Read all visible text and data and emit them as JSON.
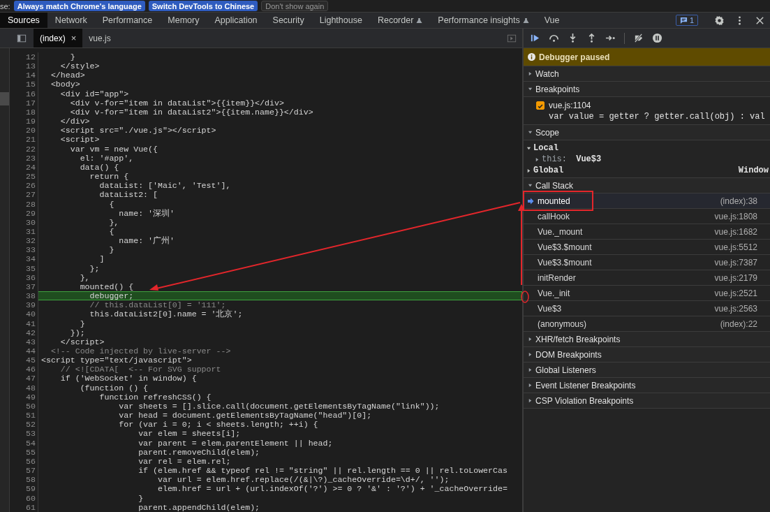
{
  "infobar": {
    "prefix": "se:",
    "buttons": [
      "Always match Chrome's language",
      "Switch DevTools to Chinese"
    ],
    "dismiss": "Don't show again"
  },
  "tabs": [
    {
      "label": "Sources",
      "selected": true,
      "experimental": false
    },
    {
      "label": "Network",
      "selected": false,
      "experimental": false
    },
    {
      "label": "Performance",
      "selected": false,
      "experimental": false
    },
    {
      "label": "Memory",
      "selected": false,
      "experimental": false
    },
    {
      "label": "Application",
      "selected": false,
      "experimental": false
    },
    {
      "label": "Security",
      "selected": false,
      "experimental": false
    },
    {
      "label": "Lighthouse",
      "selected": false,
      "experimental": false
    },
    {
      "label": "Recorder",
      "selected": false,
      "experimental": true
    },
    {
      "label": "Performance insights",
      "selected": false,
      "experimental": true
    },
    {
      "label": "Vue",
      "selected": false,
      "experimental": false
    }
  ],
  "issues_badge": "1",
  "file_tabs": [
    {
      "label": "(index)",
      "selected": true,
      "close": "×"
    },
    {
      "label": "vue.js",
      "selected": false
    }
  ],
  "code": {
    "lines": [
      {
        "number": "12",
        "text": "      }",
        "kind": "code",
        "paused": false
      },
      {
        "number": "13",
        "text": "    </style>",
        "kind": "code",
        "paused": false
      },
      {
        "number": "14",
        "text": "  </head>",
        "kind": "code",
        "paused": false
      },
      {
        "number": "15",
        "text": "  <body>",
        "kind": "code",
        "paused": false
      },
      {
        "number": "16",
        "text": "    <div id=\"app\">",
        "kind": "code",
        "paused": false
      },
      {
        "number": "17",
        "text": "      <div v-for=\"item in dataList\">{{item}}</div>",
        "kind": "code",
        "paused": false
      },
      {
        "number": "18",
        "text": "      <div v-for=\"item in dataList2\">{{item.name}}</div>",
        "kind": "code",
        "paused": false
      },
      {
        "number": "19",
        "text": "    </div>",
        "kind": "code",
        "paused": false
      },
      {
        "number": "20",
        "text": "    <script src=\"./vue.js\"></script>",
        "kind": "code",
        "paused": false
      },
      {
        "number": "21",
        "text": "    <script>",
        "kind": "code",
        "paused": false
      },
      {
        "number": "22",
        "text": "      var vm = new Vue({",
        "kind": "code",
        "paused": false
      },
      {
        "number": "23",
        "text": "        el: '#app',",
        "kind": "code",
        "paused": false
      },
      {
        "number": "24",
        "text": "        data() {",
        "kind": "code",
        "paused": false
      },
      {
        "number": "25",
        "text": "          return {",
        "kind": "code",
        "paused": false
      },
      {
        "number": "26",
        "text": "            dataList: ['Maic', 'Test'],",
        "kind": "code",
        "paused": false
      },
      {
        "number": "27",
        "text": "            dataList2: [",
        "kind": "code",
        "paused": false
      },
      {
        "number": "28",
        "text": "              {",
        "kind": "code",
        "paused": false
      },
      {
        "number": "29",
        "text": "                name: '深圳'",
        "kind": "code",
        "paused": false
      },
      {
        "number": "30",
        "text": "              },",
        "kind": "code",
        "paused": false
      },
      {
        "number": "31",
        "text": "              {",
        "kind": "code",
        "paused": false
      },
      {
        "number": "32",
        "text": "                name: '广州'",
        "kind": "code",
        "paused": false
      },
      {
        "number": "33",
        "text": "              }",
        "kind": "code",
        "paused": false
      },
      {
        "number": "34",
        "text": "            ]",
        "kind": "code",
        "paused": false
      },
      {
        "number": "35",
        "text": "          };",
        "kind": "code",
        "paused": false
      },
      {
        "number": "36",
        "text": "        },",
        "kind": "code",
        "paused": false
      },
      {
        "number": "37",
        "text": "        mounted() {",
        "kind": "code",
        "paused": false
      },
      {
        "number": "38",
        "text": "          debugger;",
        "kind": "code",
        "paused": true
      },
      {
        "number": "39",
        "text": "          // this.dataList[0] = '111';",
        "kind": "comment",
        "paused": false
      },
      {
        "number": "40",
        "text": "          this.dataList2[0].name = '北京';",
        "kind": "code",
        "paused": false
      },
      {
        "number": "41",
        "text": "        }",
        "kind": "code",
        "paused": false
      },
      {
        "number": "42",
        "text": "      });",
        "kind": "code",
        "paused": false
      },
      {
        "number": "43",
        "text": "    </script>",
        "kind": "code",
        "paused": false
      },
      {
        "number": "44",
        "text": "  <!-- Code injected by live-server -->",
        "kind": "comment",
        "paused": false
      },
      {
        "number": "45",
        "text": "<script type=\"text/javascript\">",
        "kind": "code",
        "paused": false
      },
      {
        "number": "46",
        "text": "    // <![CDATA[  <-- For SVG support",
        "kind": "comment",
        "paused": false
      },
      {
        "number": "47",
        "text": "    if ('WebSocket' in window) {",
        "kind": "code",
        "paused": false
      },
      {
        "number": "48",
        "text": "        (function () {",
        "kind": "code",
        "paused": false
      },
      {
        "number": "49",
        "text": "            function refreshCSS() {",
        "kind": "code",
        "paused": false
      },
      {
        "number": "50",
        "text": "                var sheets = [].slice.call(document.getElementsByTagName(\"link\"));",
        "kind": "code",
        "paused": false
      },
      {
        "number": "51",
        "text": "                var head = document.getElementsByTagName(\"head\")[0];",
        "kind": "code",
        "paused": false
      },
      {
        "number": "52",
        "text": "                for (var i = 0; i < sheets.length; ++i) {",
        "kind": "code",
        "paused": false
      },
      {
        "number": "53",
        "text": "                    var elem = sheets[i];",
        "kind": "code",
        "paused": false
      },
      {
        "number": "54",
        "text": "                    var parent = elem.parentElement || head;",
        "kind": "code",
        "paused": false
      },
      {
        "number": "55",
        "text": "                    parent.removeChild(elem);",
        "kind": "code",
        "paused": false
      },
      {
        "number": "56",
        "text": "                    var rel = elem.rel;",
        "kind": "code",
        "paused": false
      },
      {
        "number": "57",
        "text": "                    if (elem.href && typeof rel != \"string\" || rel.length == 0 || rel.toLowerCas",
        "kind": "code",
        "paused": false
      },
      {
        "number": "58",
        "text": "                        var url = elem.href.replace(/(&|\\?)_cacheOverride=\\d+/, '');",
        "kind": "code",
        "paused": false
      },
      {
        "number": "59",
        "text": "                        elem.href = url + (url.indexOf('?') >= 0 ? '&' : '?') + '_cacheOverride=",
        "kind": "code",
        "paused": false
      },
      {
        "number": "60",
        "text": "                    }",
        "kind": "code",
        "paused": false
      },
      {
        "number": "61",
        "text": "                    parent.appendChild(elem);",
        "kind": "code",
        "paused": false
      }
    ]
  },
  "sidebar": {
    "banner": "Debugger paused",
    "sections": [
      {
        "title": "Watch",
        "expanded": false
      },
      {
        "kind": "breakpoints",
        "title": "Breakpoints",
        "expanded": true,
        "items": [
          {
            "file": "vue.js:1104",
            "code": "var value = getter ? getter.call(obj) : val",
            "checked": true
          }
        ]
      },
      {
        "kind": "scope",
        "title": "Scope",
        "expanded": true,
        "scopes": [
          {
            "label": "Local",
            "expanded": true,
            "children": [
              {
                "name": "this:",
                "value": "Vue$3",
                "expanded": false
              }
            ]
          },
          {
            "label": "Global",
            "expanded": false,
            "value": "Window"
          }
        ]
      },
      {
        "kind": "callstack",
        "title": "Call Stack",
        "expanded": true,
        "frames": [
          {
            "function": "mounted",
            "location": "(index):38",
            "selected": true
          },
          {
            "function": "callHook",
            "location": "vue.js:1808",
            "selected": false
          },
          {
            "function": "Vue._mount",
            "location": "vue.js:1682",
            "selected": false
          },
          {
            "function": "Vue$3.$mount",
            "location": "vue.js:5512",
            "selected": false
          },
          {
            "function": "Vue$3.$mount",
            "location": "vue.js:7387",
            "selected": false
          },
          {
            "function": "initRender",
            "location": "vue.js:2179",
            "selected": false
          },
          {
            "function": "Vue._init",
            "location": "vue.js:2521",
            "selected": false
          },
          {
            "function": "Vue$3",
            "location": "vue.js:2563",
            "selected": false
          },
          {
            "function": "(anonymous)",
            "location": "(index):22",
            "selected": false
          }
        ]
      },
      {
        "title": "XHR/fetch Breakpoints",
        "expanded": false
      },
      {
        "title": "DOM Breakpoints",
        "expanded": false
      },
      {
        "title": "Global Listeners",
        "expanded": false
      },
      {
        "title": "Event Listener Breakpoints",
        "expanded": false
      },
      {
        "title": "CSP Violation Breakpoints",
        "expanded": false
      }
    ]
  }
}
